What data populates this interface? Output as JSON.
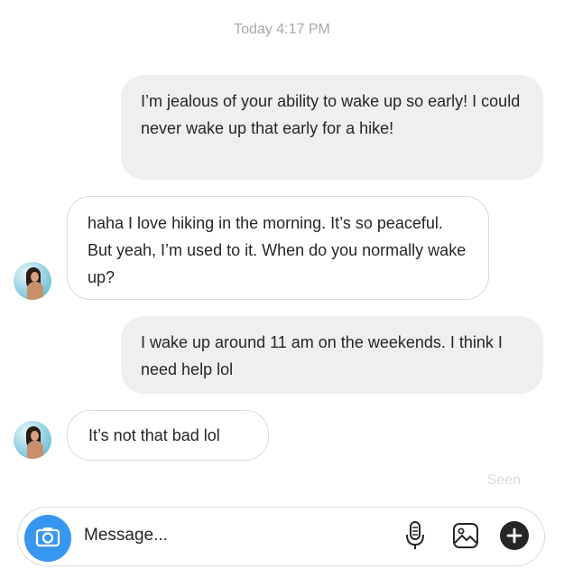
{
  "thread": {
    "timestamp": "Today 4:17 PM",
    "seen_label": "Seen"
  },
  "messages": [
    {
      "sender": "me",
      "text": "I’m jealous of your ability to wake up so early! I could never wake up that early for a hike!"
    },
    {
      "sender": "them",
      "text": "haha I love hiking in the morning. It’s so peaceful. But yeah, I’m used to it. When do you normally wake up?"
    },
    {
      "sender": "me",
      "text": "I wake up around 11 am on the weekends. I think I need help lol"
    },
    {
      "sender": "them",
      "text": "It’s not that bad lol"
    }
  ],
  "composer": {
    "placeholder": "Message...",
    "icons": [
      "camera-icon",
      "microphone-icon",
      "image-icon",
      "plus-icon"
    ]
  },
  "colors": {
    "sent_bubble": "#efefef",
    "received_border": "#dbdbdb",
    "camera_button": "#3797f0",
    "timestamp_text": "#a8a8a8"
  }
}
